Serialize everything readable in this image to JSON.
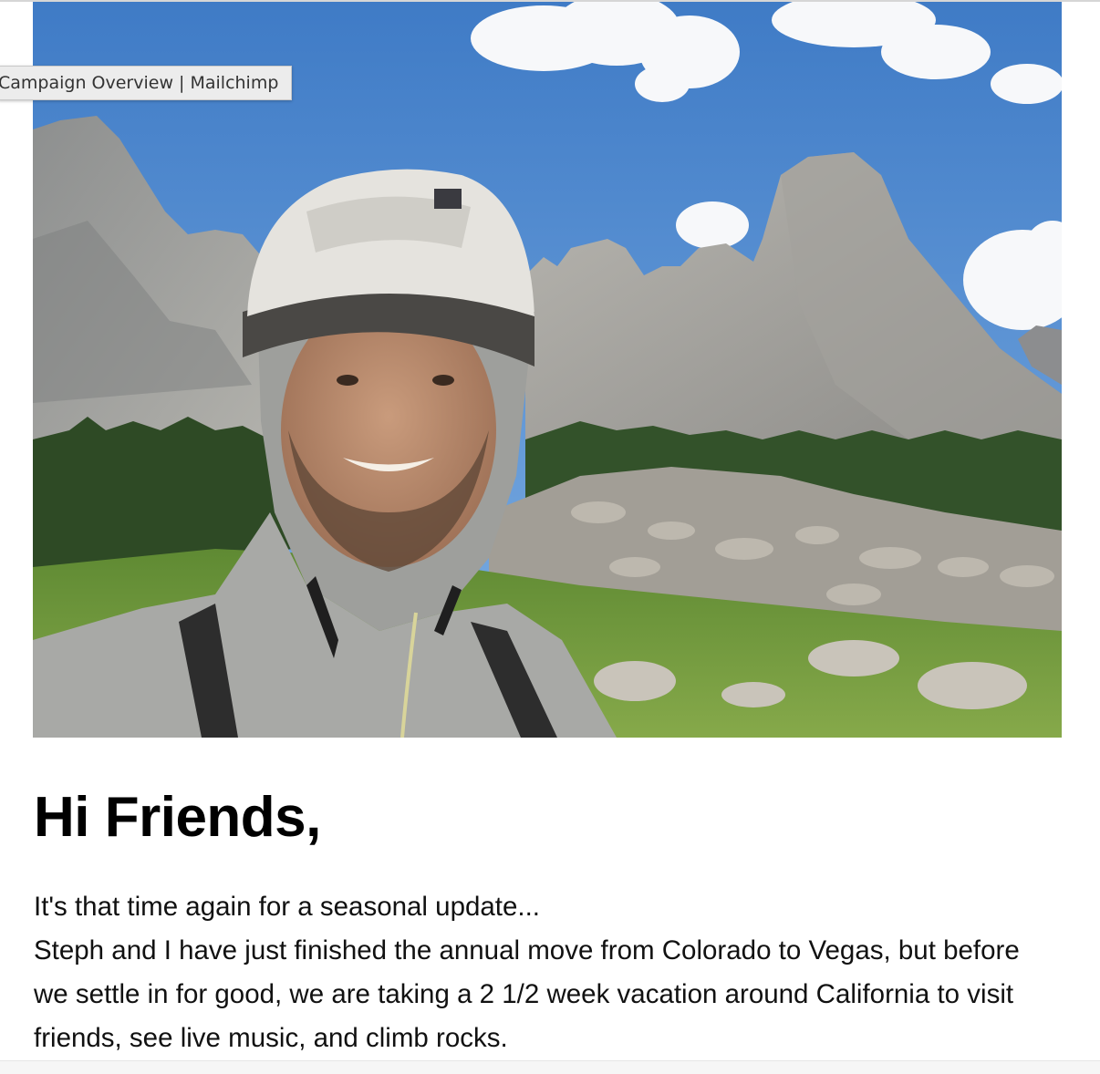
{
  "tooltip": {
    "text": "Campaign Overview | Mailchimp"
  },
  "hero_image": {
    "alt": "Selfie of a smiling man in a white climbing helmet and grey hood in front of granite mountain peaks, boulder field and pine trees under a blue sky",
    "colors": {
      "sky": "#4d86cd",
      "rock": "#9a9a96",
      "trees": "#2f4a26",
      "grass": "#6f9a3a",
      "helmet": "#e4e2dc",
      "shirt": "#a6a7a4"
    }
  },
  "email": {
    "greeting": "Hi Friends,",
    "paragraphs": [
      "It's that time again for a seasonal update...",
      "Steph and I have just finished the annual move from Colorado to Vegas, but before we settle in for good, we are taking a 2 1/2 week vacation around California to visit friends, see live music, and climb rocks."
    ]
  }
}
